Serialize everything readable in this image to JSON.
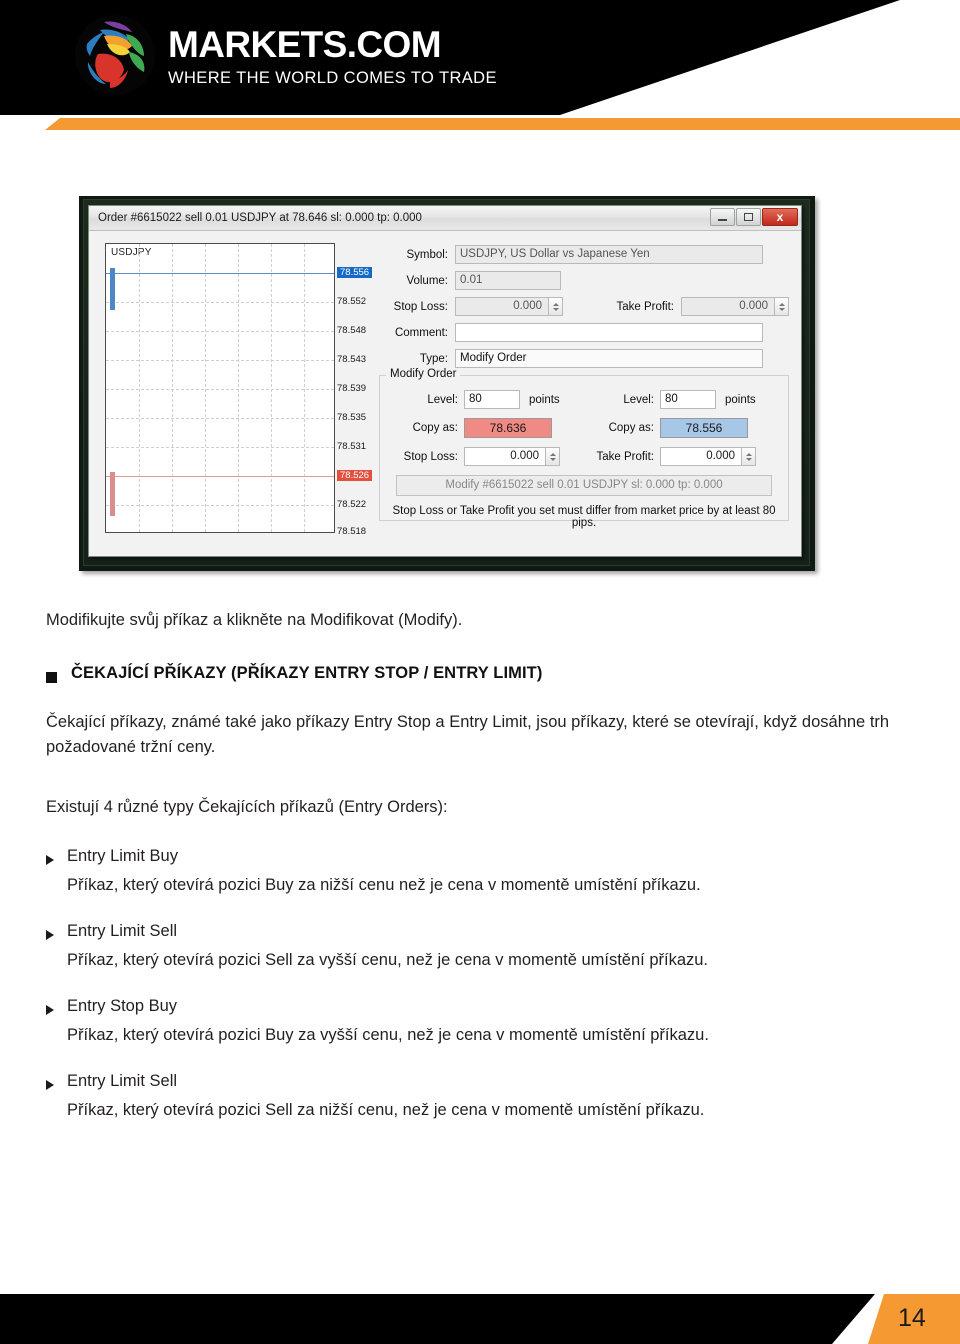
{
  "header": {
    "logo_title": "MARKETS.COM",
    "logo_tagline": "WHERE THE WORLD COMES TO TRADE",
    "accent_color": "#f59a32",
    "bar_color": "#000000"
  },
  "screenshot": {
    "window": {
      "title": "Order #6615022 sell 0.01 USDJPY at 78.646 sl: 0.000 tp: 0.000",
      "buttons": {
        "minimize": "minimize-icon",
        "maximize": "maximize-icon",
        "close": "x"
      }
    },
    "chart": {
      "symbol_label": "USDJPY",
      "bid_label": "78.556",
      "ask_label": "78.526",
      "ticks": [
        "78.556",
        "78.552",
        "78.548",
        "78.543",
        "78.539",
        "78.535",
        "78.531",
        "78.526",
        "78.522",
        "78.518"
      ]
    },
    "form": {
      "symbol_label": "Symbol:",
      "symbol_value": "USDJPY, US Dollar vs Japanese Yen",
      "volume_label": "Volume:",
      "volume_value": "0.01",
      "stop_loss_label": "Stop Loss:",
      "stop_loss_value": "0.000",
      "take_profit_label": "Take Profit:",
      "take_profit_value": "0.000",
      "comment_label": "Comment:",
      "comment_value": "",
      "type_label": "Type:",
      "type_value": "Modify Order"
    },
    "modify_group": {
      "legend": "Modify Order",
      "left": {
        "level_label": "Level:",
        "level_value": "80",
        "points_label": "points",
        "copy_as_label": "Copy as:",
        "copy_as_value": "78.636",
        "copy_as_color": "#f08a85",
        "stop_label": "Stop Loss:",
        "stop_value": "0.000"
      },
      "right": {
        "level_label": "Level:",
        "level_value": "80",
        "points_label": "points",
        "copy_as_label": "Copy as:",
        "copy_as_value": "78.556",
        "copy_as_color": "#a7c7e7",
        "stop_label": "Take Profit:",
        "stop_value": "0.000"
      },
      "modify_button": "Modify #6615022 sell 0.01 USDJPY sl: 0.000 tp: 0.000",
      "warning": "Stop Loss or Take Profit you set must differ from market price by at least 80 pips."
    }
  },
  "content": {
    "intro": "Modifikujte svůj příkaz a klikněte na Modifikovat (Modify).",
    "section_heading": "ČEKAJÍCÍ PŘÍKAZY (PŘÍKAZY ENTRY STOP / ENTRY LIMIT)",
    "paragraph": "Čekající příkazy, známé také jako příkazy Entry Stop a Entry Limit, jsou příkazy, které se otevírají, když dosáhne trh požadované tržní ceny.",
    "list_intro": "Existují 4 různé typy Čekajících příkazů (Entry Orders):",
    "items": [
      {
        "title": "Entry Limit Buy",
        "desc": "Příkaz, který otevírá pozici Buy za nižší cenu než je cena v momentě umístění příkazu."
      },
      {
        "title": "Entry Limit Sell",
        "desc": "Příkaz, který otevírá pozici Sell za vyšší cenu, než je cena v momentě umístění příkazu."
      },
      {
        "title": "Entry Stop Buy",
        "desc": "Příkaz, který otevírá pozici Buy za vyšší cenu, než je cena v momentě umístění příkazu."
      },
      {
        "title": "Entry Limit Sell",
        "desc": "Příkaz, který otevírá pozici Sell za nižší cenu, než je cena v momentě umístění příkazu."
      }
    ]
  },
  "footer": {
    "page_number": "14",
    "bar_color": "#000000",
    "accent_color": "#f59a32"
  }
}
